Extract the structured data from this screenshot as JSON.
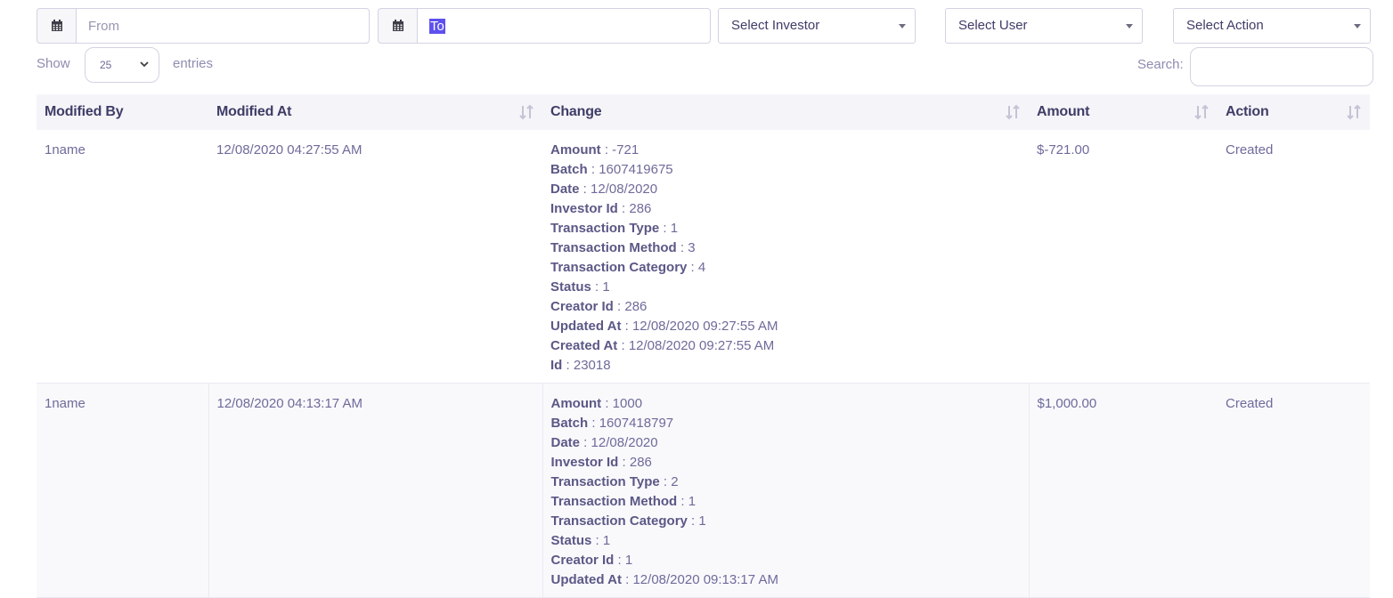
{
  "filters": {
    "from_placeholder": "From",
    "to_value": "To",
    "investor": "Select Investor",
    "user": "Select User",
    "action": "Select Action"
  },
  "length": {
    "show": "Show",
    "value": "25",
    "entries": "entries"
  },
  "search": {
    "label": "Search:",
    "value": ""
  },
  "table": {
    "headers": [
      "Modified By",
      "Modified At",
      "Change",
      "Amount",
      "Action"
    ],
    "rows": [
      {
        "modified_by": "1name",
        "modified_at": "12/08/2020 04:27:55 AM",
        "changes": [
          {
            "key": "Amount",
            "value": "-721"
          },
          {
            "key": "Batch",
            "value": "1607419675"
          },
          {
            "key": "Date",
            "value": "12/08/2020"
          },
          {
            "key": "Investor Id",
            "value": "286"
          },
          {
            "key": "Transaction Type",
            "value": "1"
          },
          {
            "key": "Transaction Method",
            "value": "3"
          },
          {
            "key": "Transaction Category",
            "value": "4"
          },
          {
            "key": "Status",
            "value": "1"
          },
          {
            "key": "Creator Id",
            "value": "286"
          },
          {
            "key": "Updated At",
            "value": "12/08/2020 09:27:55 AM"
          },
          {
            "key": "Created At",
            "value": "12/08/2020 09:27:55 AM"
          },
          {
            "key": "Id",
            "value": "23018"
          }
        ],
        "amount": "$-721.00",
        "action": "Created"
      },
      {
        "modified_by": "1name",
        "modified_at": "12/08/2020 04:13:17 AM",
        "changes": [
          {
            "key": "Amount",
            "value": "1000"
          },
          {
            "key": "Batch",
            "value": "1607418797"
          },
          {
            "key": "Date",
            "value": "12/08/2020"
          },
          {
            "key": "Investor Id",
            "value": "286"
          },
          {
            "key": "Transaction Type",
            "value": "2"
          },
          {
            "key": "Transaction Method",
            "value": "1"
          },
          {
            "key": "Transaction Category",
            "value": "1"
          },
          {
            "key": "Status",
            "value": "1"
          },
          {
            "key": "Creator Id",
            "value": "1"
          },
          {
            "key": "Updated At",
            "value": "12/08/2020 09:13:17 AM"
          }
        ],
        "amount": "$1,000.00",
        "action": "Created"
      }
    ]
  },
  "colors": {
    "accent": "#5e50ee",
    "text": "#6e6b9a",
    "heading": "#3f3d67"
  },
  "icons": {
    "calendar": "calendar-icon",
    "sort": "sort-icon"
  }
}
